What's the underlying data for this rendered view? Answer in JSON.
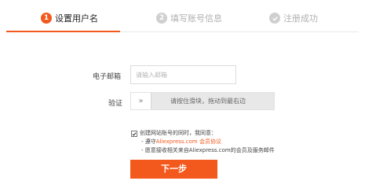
{
  "steps": [
    {
      "num": "1",
      "label": "设置用户名"
    },
    {
      "num": "2",
      "label": "填写账号信息"
    },
    {
      "label": "注册成功"
    }
  ],
  "form": {
    "email_label": "电子邮箱",
    "email_placeholder": "请输入邮箱",
    "verify_label": "验证",
    "slider_handle_glyph": "»",
    "slider_text": "请按住滑块，拖动到最右边",
    "agreement": {
      "intro": "创建网站账号的同时，我同意：",
      "line1_prefix": "- 遵守",
      "line1_brand": "Aliexpress.com",
      "line1_link": " 会员协议",
      "line2": "- 愿意接收相关来自Aliexpress.com的会员及服务邮件"
    },
    "next_button": "下一步"
  },
  "colors": {
    "accent": "#f3581c",
    "inactive": "#b0b0b0"
  }
}
